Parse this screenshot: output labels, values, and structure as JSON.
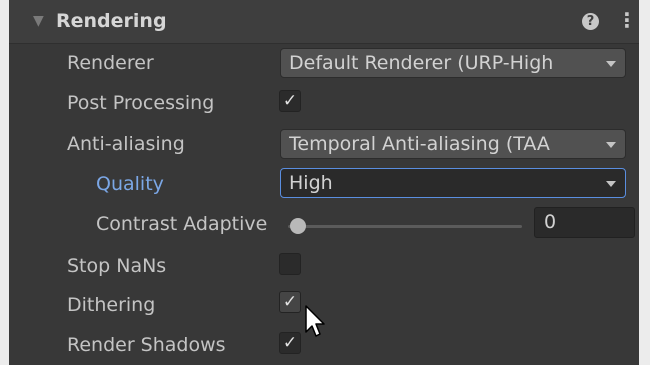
{
  "section": {
    "title": "Rendering"
  },
  "rows": {
    "renderer": {
      "label": "Renderer",
      "value": "Default Renderer (URP-High"
    },
    "post_processing": {
      "label": "Post Processing",
      "checked": true
    },
    "anti_aliasing": {
      "label": "Anti-aliasing",
      "value": "Temporal Anti-aliasing (TAA"
    },
    "quality": {
      "label": "Quality",
      "value": "High"
    },
    "contrast_adaptive": {
      "label": "Contrast Adaptive Sharpening",
      "value": "0",
      "slider_fraction": 0.0
    },
    "stop_nans": {
      "label": "Stop NaNs",
      "checked": false
    },
    "dithering": {
      "label": "Dithering",
      "checked": true
    },
    "render_shadows": {
      "label": "Render Shadows",
      "checked": true
    }
  },
  "icons": {
    "check": "✓",
    "help": "?",
    "more": "⋮",
    "foldout": "▼"
  },
  "colors": {
    "panel": "#383838",
    "active_label": "#7ba7e6",
    "focus_border": "#5a8ee0"
  }
}
